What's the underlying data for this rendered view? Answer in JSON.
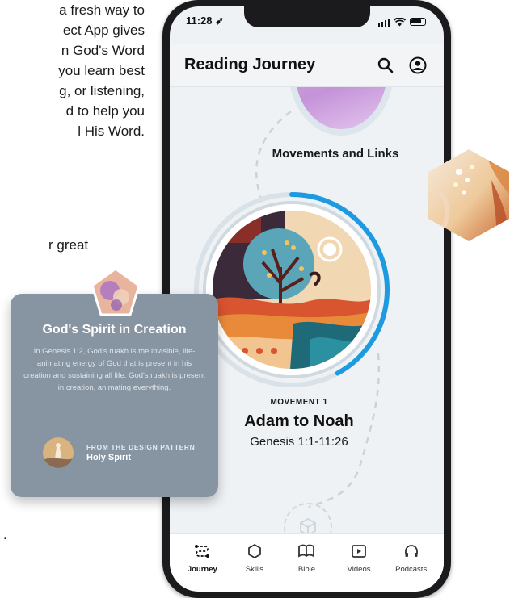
{
  "background": {
    "lines": [
      "a fresh way to",
      "ect App gives",
      "n God's Word",
      "you learn best",
      "g, or listening,",
      "d to help you",
      "l His Word."
    ],
    "line2": "r great",
    "dot": "."
  },
  "status_bar": {
    "time": "11:28 ➶"
  },
  "header": {
    "title": "Reading Journey",
    "search_icon": "search-icon",
    "profile_icon": "profile-icon"
  },
  "journey": {
    "prev_movement_title": "Movements and Links",
    "current": {
      "eyebrow": "MOVEMENT 1",
      "title": "Adam to Noah",
      "reference": "Genesis 1:1-11:26",
      "progress": 0.42
    }
  },
  "tabs": [
    {
      "label": "Journey",
      "icon": "journey-icon",
      "active": true
    },
    {
      "label": "Skills",
      "icon": "skills-icon",
      "active": false
    },
    {
      "label": "Bible",
      "icon": "bible-icon",
      "active": false
    },
    {
      "label": "Videos",
      "icon": "videos-icon",
      "active": false
    },
    {
      "label": "Podcasts",
      "icon": "podcasts-icon",
      "active": false
    }
  ],
  "card": {
    "title": "God's Spirit in Creation",
    "body": "In Genesis 1:2, God's ruakh is the invisible, life-animating energy of God that is present in his creation and sustaining all life. God's ruakh is present in creation, animating everything.",
    "eyebrow": "FROM THE DESIGN PATTERN",
    "pattern": "Holy Spirit"
  },
  "colors": {
    "accent": "#1e9be0",
    "card_bg": "#8794a2",
    "screen_bg": "#eef2f5"
  }
}
